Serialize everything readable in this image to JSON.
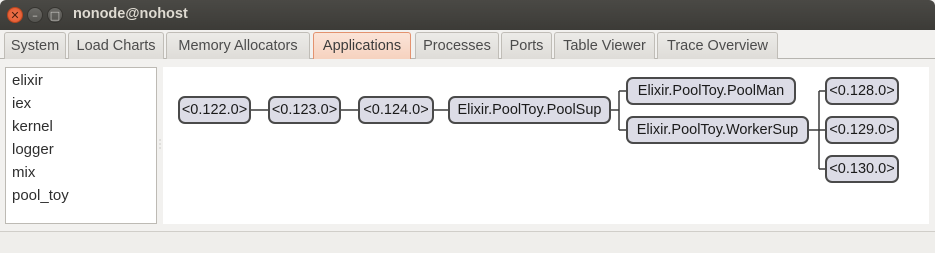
{
  "window": {
    "title": "nonode@nohost"
  },
  "tabs": [
    {
      "label": "System",
      "active": false
    },
    {
      "label": "Load Charts",
      "active": false
    },
    {
      "label": "Memory Allocators",
      "active": false
    },
    {
      "label": "Applications",
      "active": true
    },
    {
      "label": "Processes",
      "active": false
    },
    {
      "label": "Ports",
      "active": false
    },
    {
      "label": "Table Viewer",
      "active": false
    },
    {
      "label": "Trace Overview",
      "active": false
    }
  ],
  "applications": [
    "elixir",
    "iex",
    "kernel",
    "logger",
    "mix",
    "pool_toy"
  ],
  "process_tree": {
    "nodes": {
      "p122": "<0.122.0>",
      "p123": "<0.123.0>",
      "p124": "<0.124.0>",
      "pool_sup": "Elixir.PoolToy.PoolSup",
      "pool_man": "Elixir.PoolToy.PoolMan",
      "worker_sup": "Elixir.PoolToy.WorkerSup",
      "p128": "<0.128.0>",
      "p129": "<0.129.0>",
      "p130": "<0.130.0>"
    }
  },
  "colors": {
    "active_tab_border": "#e3926f",
    "node_fill": "#dcdce6",
    "close_button": "#e2532a"
  }
}
